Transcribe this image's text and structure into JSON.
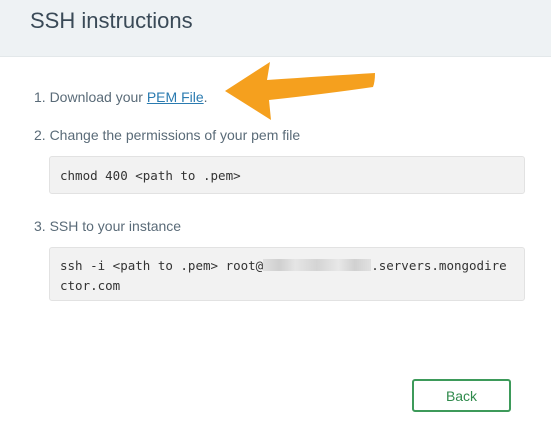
{
  "header": {
    "title": "SSH instructions"
  },
  "steps": [
    {
      "prefix": "1. Download your ",
      "link": "PEM File",
      "suffix": "."
    },
    {
      "text": "2. Change the permissions of your pem file"
    },
    {
      "text": "3. SSH to your instance"
    }
  ],
  "commands": {
    "chmod": "chmod 400 <path to .pem>",
    "ssh_prefix": "ssh -i <path to .pem> root@",
    "ssh_suffix": ".servers.mongodirector.com"
  },
  "actions": {
    "back_label": "Back"
  },
  "colors": {
    "header_bg": "#eef2f4",
    "link": "#2b7bb0",
    "arrow": "#f5a01e",
    "button_border": "#3d9a5a"
  }
}
